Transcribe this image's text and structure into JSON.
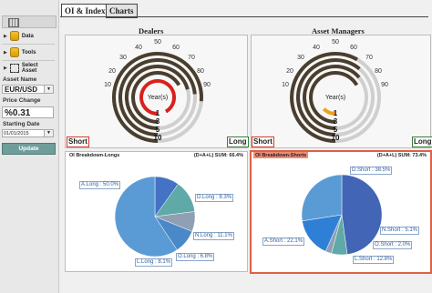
{
  "tabs": [
    {
      "label": "OI & Index",
      "active": true
    },
    {
      "label": "Charts",
      "active": false
    }
  ],
  "sidebar": {
    "items": [
      {
        "label": "Data",
        "icon": "database-icon"
      },
      {
        "label": "Tools",
        "icon": "tools-icon"
      },
      {
        "label": "Select Asset",
        "icon": "selection-icon"
      }
    ],
    "asset_name_label": "Asset Name",
    "asset_value": "EUR/USD",
    "price_change_label": "Price Change",
    "price_change_value": "%0.31",
    "starting_date_label": "Starting Date",
    "starting_date_value": "01/01/2015",
    "update_label": "Update"
  },
  "colors": {
    "accent": "#6f9e9a",
    "short": "#d23b2b",
    "long": "#3a7f3a",
    "ring_dark": "#4a3e2e",
    "ring_light": "#cccccc",
    "highlight": "#e06047"
  },
  "dealers": {
    "title": "Dealers",
    "center_label": "Year(s)",
    "year_labels": [
      "1",
      "3",
      "5",
      "10"
    ],
    "tick_labels": [
      "50",
      "40",
      "30",
      "20",
      "10",
      "60",
      "70",
      "80",
      "90"
    ],
    "short_label": "Short",
    "long_label": "Long",
    "active_toggle": "Short"
  },
  "asset_managers": {
    "title": "Asset Managers",
    "center_label": "Year(s)",
    "year_labels": [
      "1",
      "3",
      "5",
      "10"
    ],
    "tick_labels": [
      "50",
      "40",
      "30",
      "20",
      "10",
      "60",
      "70",
      "80",
      "90"
    ],
    "short_label": "Short",
    "long_label": "Long",
    "active_toggle": "Short"
  },
  "pie_longs": {
    "title": "OI Breakdown-Longs",
    "sum_label": "(D+A+L) SUM: 66.4%",
    "slices": [
      {
        "label": "A.Long : 50.0%",
        "value": 50.0,
        "color": "#5b9bd5"
      },
      {
        "label": "D.Long : 8.3%",
        "value": 8.3,
        "color": "#4472c4"
      },
      {
        "label": "N.Long : 11.1%",
        "value": 11.1,
        "color": "#5fa9a8"
      },
      {
        "label": "O.Long : 6.8%",
        "value": 6.8,
        "color": "#8f9fb4"
      },
      {
        "label": "L.Long : 8.1%",
        "value": 8.1,
        "color": "#4b88c7"
      }
    ]
  },
  "pie_shorts": {
    "title": "OI Breakdown-Shorts",
    "sum_label": "(D+A+L) SUM: 73.4%",
    "slices": [
      {
        "label": "D.Short : 38.5%",
        "value": 38.5,
        "color": "#4266b5"
      },
      {
        "label": "N.Short : 5.1%",
        "value": 5.1,
        "color": "#5fa9a8"
      },
      {
        "label": "O.Short : 2.0%",
        "value": 2.0,
        "color": "#8f9fb4"
      },
      {
        "label": "L.Short : 12.8%",
        "value": 12.8,
        "color": "#2f7fd6"
      },
      {
        "label": "A.Short : 22.1%",
        "value": 22.1,
        "color": "#5b9bd5"
      }
    ]
  }
}
